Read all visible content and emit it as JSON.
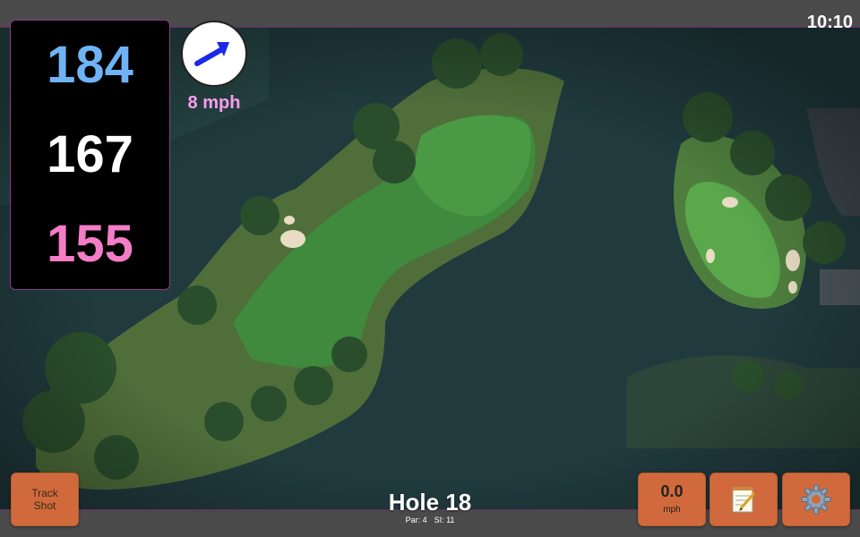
{
  "clock": "10:10",
  "distances": {
    "back": "184",
    "middle": "167",
    "front": "155"
  },
  "wind": {
    "speed": "8 mph",
    "direction_icon": "wind-arrow-icon"
  },
  "buttons": {
    "track_shot": {
      "line1": "Track",
      "line2": "Shot"
    },
    "speed": {
      "value": "0.0",
      "unit": "mph"
    },
    "notes_icon": "notepad-icon",
    "settings_icon": "gear-icon"
  },
  "hole": {
    "title": "Hole 18",
    "par": "Par: 4",
    "si": "SI: 11"
  },
  "colors": {
    "accent": "#d06a3c",
    "back": "#6fb3f5",
    "front": "#f47dc7",
    "wind_text": "#ff9cf0",
    "border": "#8a3b8a"
  }
}
